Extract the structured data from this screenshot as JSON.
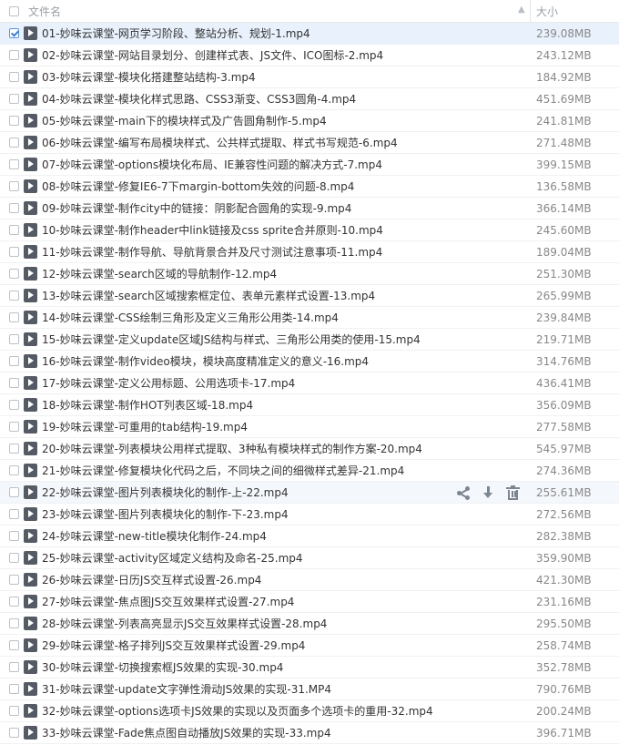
{
  "header": {
    "name_label": "文件名",
    "size_label": "大小",
    "sort_icon": "sort-up-icon"
  },
  "files": [
    {
      "name": "01-妙味云课堂-网页学习阶段、整站分析、规划-1.mp4",
      "size": "239.08MB",
      "selected": true
    },
    {
      "name": "02-妙味云课堂-网站目录划分、创建样式表、JS文件、ICO图标-2.mp4",
      "size": "243.12MB"
    },
    {
      "name": "03-妙味云课堂-模块化搭建整站结构-3.mp4",
      "size": "184.92MB"
    },
    {
      "name": "04-妙味云课堂-模块化样式思路、CSS3渐变、CSS3圆角-4.mp4",
      "size": "451.69MB"
    },
    {
      "name": "05-妙味云课堂-main下的模块样式及广告圆角制作-5.mp4",
      "size": "241.81MB"
    },
    {
      "name": "06-妙味云课堂-编写布局模块样式、公共样式提取、样式书写规范-6.mp4",
      "size": "271.48MB"
    },
    {
      "name": "07-妙味云课堂-options模块化布局、IE兼容性问题的解决方式-7.mp4",
      "size": "399.15MB"
    },
    {
      "name": "08-妙味云课堂-修复IE6-7下margin-bottom失效的问题-8.mp4",
      "size": "136.58MB"
    },
    {
      "name": "09-妙味云课堂-制作city中的链接：阴影配合圆角的实现-9.mp4",
      "size": "366.14MB"
    },
    {
      "name": "10-妙味云课堂-制作header中link链接及css sprite合并原则-10.mp4",
      "size": "245.60MB"
    },
    {
      "name": "11-妙味云课堂-制作导航、导航背景合并及尺寸测试注意事项-11.mp4",
      "size": "189.04MB"
    },
    {
      "name": "12-妙味云课堂-search区域的导航制作-12.mp4",
      "size": "251.30MB"
    },
    {
      "name": "13-妙味云课堂-search区域搜索框定位、表单元素样式设置-13.mp4",
      "size": "265.99MB"
    },
    {
      "name": "14-妙味云课堂-CSS绘制三角形及定义三角形公用类-14.mp4",
      "size": "239.84MB"
    },
    {
      "name": "15-妙味云课堂-定义update区域JS结构与样式、三角形公用类的使用-15.mp4",
      "size": "219.71MB"
    },
    {
      "name": "16-妙味云课堂-制作video模块，模块高度精准定义的意义-16.mp4",
      "size": "314.76MB"
    },
    {
      "name": "17-妙味云课堂-定义公用标题、公用选项卡-17.mp4",
      "size": "436.41MB"
    },
    {
      "name": "18-妙味云课堂-制作HOT列表区域-18.mp4",
      "size": "356.09MB"
    },
    {
      "name": "19-妙味云课堂-可重用的tab结构-19.mp4",
      "size": "277.58MB"
    },
    {
      "name": "20-妙味云课堂-列表模块公用样式提取、3种私有模块样式的制作方案-20.mp4",
      "size": "545.97MB"
    },
    {
      "name": "21-妙味云课堂-修复模块化代码之后，不同块之间的细微样式差异-21.mp4",
      "size": "274.36MB"
    },
    {
      "name": "22-妙味云课堂-图片列表模块化的制作-上-22.mp4",
      "size": "255.61MB",
      "hover": true
    },
    {
      "name": "23-妙味云课堂-图片列表模块化的制作-下-23.mp4",
      "size": "272.56MB"
    },
    {
      "name": "24-妙味云课堂-new-title模块化制作-24.mp4",
      "size": "282.38MB"
    },
    {
      "name": "25-妙味云课堂-activity区域定义结构及命名-25.mp4",
      "size": "359.90MB"
    },
    {
      "name": "26-妙味云课堂-日历JS交互样式设置-26.mp4",
      "size": "421.30MB"
    },
    {
      "name": "27-妙味云课堂-焦点图JS交互效果样式设置-27.mp4",
      "size": "231.16MB"
    },
    {
      "name": "28-妙味云课堂-列表高亮显示JS交互效果样式设置-28.mp4",
      "size": "295.50MB"
    },
    {
      "name": "29-妙味云课堂-格子排列JS交互效果样式设置-29.mp4",
      "size": "258.74MB"
    },
    {
      "name": "30-妙味云课堂-切换搜索框JS效果的实现-30.mp4",
      "size": "352.78MB"
    },
    {
      "name": "31-妙味云课堂-update文字弹性滑动JS效果的实现-31.MP4",
      "size": "790.76MB"
    },
    {
      "name": "32-妙味云课堂-options选项卡JS效果的实现以及页面多个选项卡的重用-32.mp4",
      "size": "200.24MB"
    },
    {
      "name": "33-妙味云课堂-Fade焦点图自动播放JS效果的实现-33.mp4",
      "size": "396.71MB"
    }
  ],
  "row_actions": {
    "share_icon": "share-icon",
    "download_icon": "download-icon",
    "delete_icon": "trash-icon"
  }
}
